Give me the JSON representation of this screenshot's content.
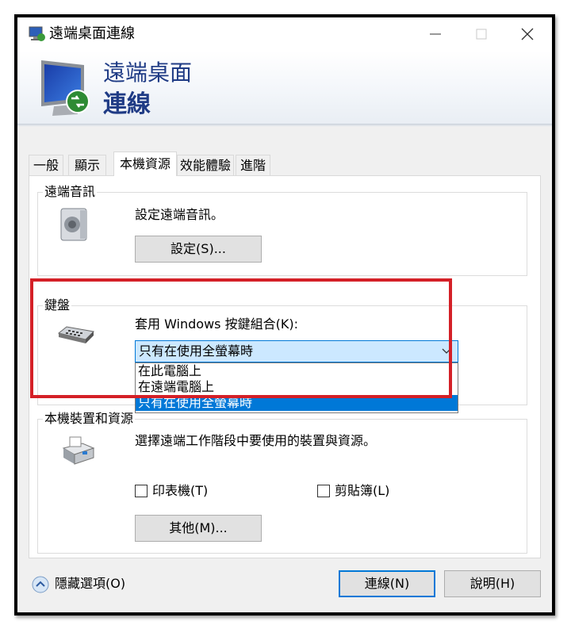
{
  "window": {
    "title": "遠端桌面連線"
  },
  "banner": {
    "line1": "遠端桌面",
    "line2": "連線"
  },
  "tabs": [
    {
      "label": "一般"
    },
    {
      "label": "顯示"
    },
    {
      "label": "本機資源"
    },
    {
      "label": "效能體驗"
    },
    {
      "label": "進階"
    }
  ],
  "audio": {
    "group_label": "遠端音訊",
    "description": "設定遠端音訊。",
    "settings_button": "設定(S)..."
  },
  "keyboard": {
    "group_label": "鍵盤",
    "prompt": "套用 Windows 按鍵組合(K):",
    "selected": "只有在使用全螢幕時",
    "options": [
      "在此電腦上",
      "在遠端電腦上",
      "只有在使用全螢幕時"
    ]
  },
  "devices": {
    "group_label": "本機裝置和資源",
    "description": "選擇遠端工作階段中要使用的裝置與資源。",
    "printers_label": "印表機(T)",
    "clipboard_label": "剪貼簿(L)",
    "more_button": "其他(M)..."
  },
  "footer": {
    "hide_options": "隱藏選項(O)",
    "connect_button": "連線(N)",
    "help_button": "說明(H)"
  },
  "colors": {
    "accent": "#0078d7",
    "banner_text": "#1f3b85",
    "annotation": "#d42027"
  }
}
